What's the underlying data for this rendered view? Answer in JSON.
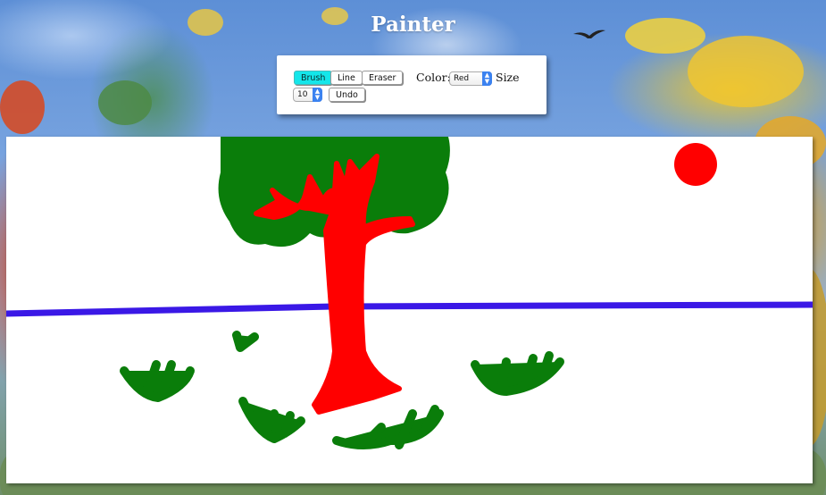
{
  "app": {
    "title": "Painter"
  },
  "toolbar": {
    "tools": [
      {
        "label": "Brush",
        "active": true
      },
      {
        "label": "Line",
        "active": false
      },
      {
        "label": "Eraser",
        "active": false
      }
    ],
    "color_label": "Color:",
    "color_value": "Red",
    "size_label": "Size",
    "size_value": "10",
    "undo_label": "Undo"
  },
  "colors": {
    "active_tool": "#14e6ea",
    "tree_trunk": "#ff0000",
    "foliage": "#0a7d0a",
    "horizon_line": "#3a18e6",
    "sun": "#ff0000",
    "canvas": "#ffffff"
  },
  "icons": [
    "bird-silhouette",
    "select-arrows-icon"
  ]
}
